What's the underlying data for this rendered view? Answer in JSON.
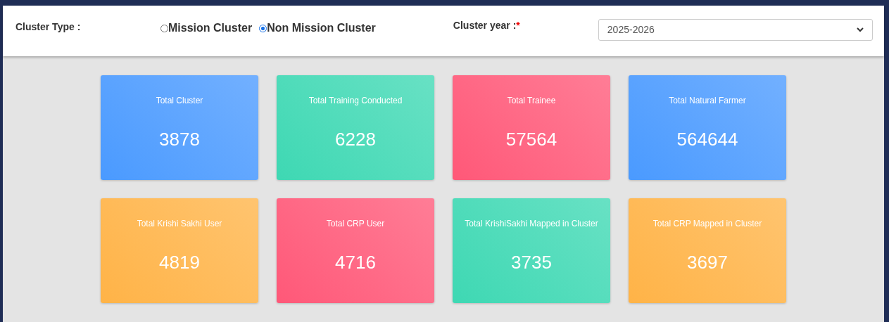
{
  "filters": {
    "cluster_type": {
      "label": "Cluster Type :",
      "options": [
        {
          "label": "Mission Cluster",
          "selected": false
        },
        {
          "label": "Non Mission Cluster",
          "selected": true
        }
      ]
    },
    "cluster_year": {
      "label": "Cluster year :",
      "required_mark": "*",
      "value": "2025-2026"
    }
  },
  "cards": [
    {
      "title": "Total Cluster",
      "value": "3878",
      "color": "#4a9aff"
    },
    {
      "title": "Total Training Conducted",
      "value": "6228",
      "color": "#3ed8b3"
    },
    {
      "title": "Total Trainee",
      "value": "57564",
      "color": "#ff5878"
    },
    {
      "title": "Total Natural Farmer",
      "value": "564644",
      "color": "#4a9aff"
    },
    {
      "title": "Total Krishi Sakhi User",
      "value": "4819",
      "color": "#ffb347"
    },
    {
      "title": "Total CRP User",
      "value": "4716",
      "color": "#ff5878"
    },
    {
      "title": "Total KrishiSakhi Mapped in Cluster",
      "value": "3735",
      "color": "#3ed8b3"
    },
    {
      "title": "Total CRP Mapped in Cluster",
      "value": "3697",
      "color": "#ffb347"
    }
  ]
}
